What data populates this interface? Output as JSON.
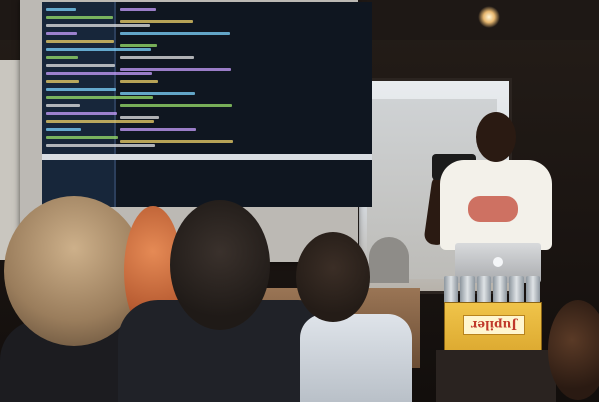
{
  "crate_label": "Jupiler"
}
